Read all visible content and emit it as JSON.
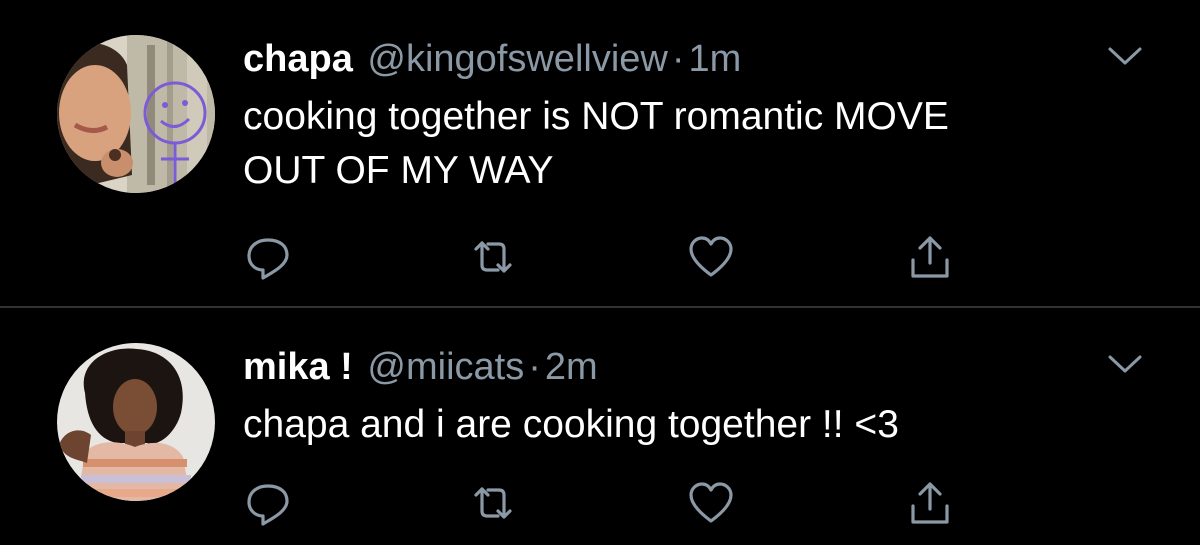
{
  "tweets": [
    {
      "name": "chapa",
      "handle": "@kingofswellview",
      "separator": "·",
      "time": "1m",
      "text_lines": [
        "cooking together is NOT romantic MOVE",
        "OUT OF MY WAY"
      ]
    },
    {
      "name": "mika !",
      "handle": "@miicats",
      "separator": "·",
      "time": "2m",
      "text_lines": [
        "chapa and i are cooking together !! <3"
      ]
    }
  ],
  "icons": {
    "reply": "reply-icon",
    "retweet": "retweet-icon",
    "like": "heart-icon",
    "share": "share-icon",
    "menu": "chevron-down-icon"
  },
  "colors": {
    "background": "#000000",
    "text": "#ffffff",
    "secondary_text": "#8b98a5",
    "icon": "#8b98a5",
    "divider": "#2f3336"
  }
}
